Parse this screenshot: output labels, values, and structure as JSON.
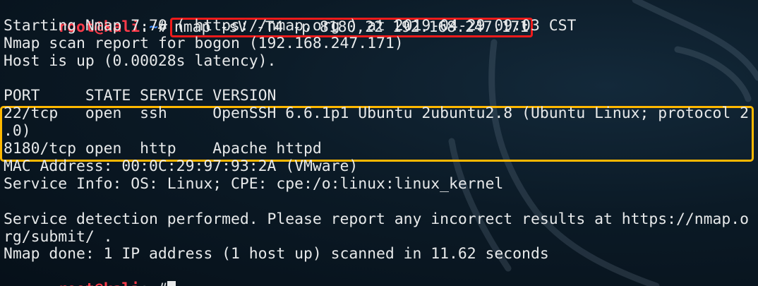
{
  "prompt": {
    "user_host": "root@kali",
    "separator": ":",
    "dir": "~",
    "symbol": "#"
  },
  "command": "nmap -sV -T4 -p 8180,22 192.168.247.171",
  "output": {
    "starting": "Starting Nmap 7.70 ( https://nmap.org ) at 2019-04-29 09:03 CST",
    "report": "Nmap scan report for bogon (192.168.247.171)",
    "host_up": "Host is up (0.00028s latency).",
    "blank1": "",
    "table_header": "PORT     STATE SERVICE VERSION",
    "rows": [
      "22/tcp   open  ssh     OpenSSH 6.6.1p1 Ubuntu 2ubuntu2.8 (Ubuntu Linux; protocol 2",
      ".0)",
      "8180/tcp open  http    Apache httpd"
    ],
    "mac": "MAC Address: 00:0C:29:97:93:2A (VMware)",
    "service_info": "Service Info: OS: Linux; CPE: cpe:/o:linux:linux_kernel",
    "blank2": "",
    "detection_1": "Service detection performed. Please report any incorrect results at https://nmap.o",
    "detection_2": "rg/submit/ .",
    "done": "Nmap done: 1 IP address (1 host up) scanned in 11.62 seconds"
  },
  "colors": {
    "prompt_user": "#ff3b4a",
    "prompt_dir": "#3c84f0",
    "command_highlight": "#ef1b1b",
    "services_highlight": "#ffb800",
    "text": "#e7e9ea"
  }
}
